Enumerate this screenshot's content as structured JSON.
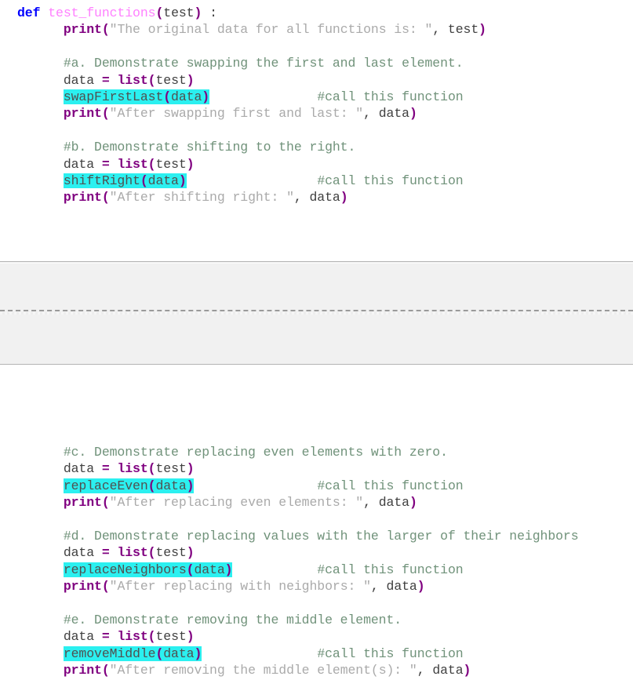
{
  "editor": {
    "language": "python",
    "colors": {
      "background": "#ffffff",
      "keyword": "#0000ff",
      "function_name": "#ff80ff",
      "builtin": "#800080",
      "punctuation": "#800080",
      "string": "#aaaaaa",
      "comment": "#70927a",
      "plain_text": "#404040",
      "highlight_background": "#2bf0f0",
      "fold_band_background": "#f1f1f1",
      "fold_band_border": "#b4b4b4"
    }
  },
  "code_top": {
    "lines": [
      {
        "id": "def-line",
        "tokens": [
          {
            "t": "def",
            "c": "def"
          },
          {
            "t": " ",
            "c": "plain"
          },
          {
            "t": "test_functions",
            "c": "fname"
          },
          {
            "t": "(",
            "c": "punct"
          },
          {
            "t": "test",
            "c": "plain"
          },
          {
            "t": ")",
            "c": "punct"
          },
          {
            "t": " :",
            "c": "plain"
          }
        ]
      },
      {
        "id": "print-original",
        "indent": 3,
        "tokens": [
          {
            "t": "print",
            "c": "builtin"
          },
          {
            "t": "(",
            "c": "punct"
          },
          {
            "t": "\"The original data for all functions is: \"",
            "c": "string"
          },
          {
            "t": ",",
            "c": "plain"
          },
          {
            "t": " test",
            "c": "plain"
          },
          {
            "t": ")",
            "c": "punct"
          }
        ]
      },
      {
        "id": "blank-1",
        "blank": true,
        "tokens": []
      },
      {
        "id": "comment-a",
        "indent": 3,
        "tokens": [
          {
            "t": "#a. Demonstrate swapping the first and last element.",
            "c": "comment"
          }
        ]
      },
      {
        "id": "data-assign-a",
        "indent": 3,
        "tokens": [
          {
            "t": "data ",
            "c": "plain"
          },
          {
            "t": "=",
            "c": "op"
          },
          {
            "t": " ",
            "c": "plain"
          },
          {
            "t": "list",
            "c": "builtin"
          },
          {
            "t": "(",
            "c": "punct"
          },
          {
            "t": "test",
            "c": "plain"
          },
          {
            "t": ")",
            "c": "punct"
          }
        ]
      },
      {
        "id": "call-swapfirstlast",
        "indent": 3,
        "highlight": {
          "text": "swapFirstLast",
          "open": "(",
          "arg": "data",
          "close": ")"
        },
        "trailing_comment": "#call this function",
        "comment_col": 39,
        "tokens": []
      },
      {
        "id": "print-after-swap",
        "indent": 3,
        "tokens": [
          {
            "t": "print",
            "c": "builtin"
          },
          {
            "t": "(",
            "c": "punct"
          },
          {
            "t": "\"After swapping first and last: \"",
            "c": "string"
          },
          {
            "t": ",",
            "c": "plain"
          },
          {
            "t": " data",
            "c": "plain"
          },
          {
            "t": ")",
            "c": "punct"
          }
        ]
      },
      {
        "id": "blank-2",
        "blank": true,
        "tokens": []
      },
      {
        "id": "comment-b",
        "indent": 3,
        "tokens": [
          {
            "t": "#b. Demonstrate shifting to the right.",
            "c": "comment"
          }
        ]
      },
      {
        "id": "data-assign-b",
        "indent": 3,
        "tokens": [
          {
            "t": "data ",
            "c": "plain"
          },
          {
            "t": "=",
            "c": "op"
          },
          {
            "t": " ",
            "c": "plain"
          },
          {
            "t": "list",
            "c": "builtin"
          },
          {
            "t": "(",
            "c": "punct"
          },
          {
            "t": "test",
            "c": "plain"
          },
          {
            "t": ")",
            "c": "punct"
          }
        ]
      },
      {
        "id": "call-shiftright",
        "indent": 3,
        "highlight": {
          "text": "shiftRight",
          "open": "(",
          "arg": "data",
          "close": ")"
        },
        "trailing_comment": "#call this function",
        "comment_col": 39,
        "tokens": []
      },
      {
        "id": "print-after-shift",
        "indent": 3,
        "tokens": [
          {
            "t": "print",
            "c": "builtin"
          },
          {
            "t": "(",
            "c": "punct"
          },
          {
            "t": "\"After shifting right: \"",
            "c": "string"
          },
          {
            "t": ",",
            "c": "plain"
          },
          {
            "t": " data",
            "c": "plain"
          },
          {
            "t": ")",
            "c": "punct"
          }
        ]
      }
    ]
  },
  "code_bottom": {
    "lines": [
      {
        "id": "comment-c",
        "indent": 3,
        "tokens": [
          {
            "t": "#c. Demonstrate replacing even elements with zero.",
            "c": "comment"
          }
        ]
      },
      {
        "id": "data-assign-c",
        "indent": 3,
        "tokens": [
          {
            "t": "data ",
            "c": "plain"
          },
          {
            "t": "=",
            "c": "op"
          },
          {
            "t": " ",
            "c": "plain"
          },
          {
            "t": "list",
            "c": "builtin"
          },
          {
            "t": "(",
            "c": "punct"
          },
          {
            "t": "test",
            "c": "plain"
          },
          {
            "t": ")",
            "c": "punct"
          }
        ]
      },
      {
        "id": "call-replaceeven",
        "indent": 3,
        "highlight": {
          "text": "replaceEven",
          "open": "(",
          "arg": "data",
          "close": ")"
        },
        "trailing_comment": "#call this function",
        "comment_col": 39,
        "tokens": []
      },
      {
        "id": "print-after-replaceeven",
        "indent": 3,
        "tokens": [
          {
            "t": "print",
            "c": "builtin"
          },
          {
            "t": "(",
            "c": "punct"
          },
          {
            "t": "\"After replacing even elements: \"",
            "c": "string"
          },
          {
            "t": ",",
            "c": "plain"
          },
          {
            "t": " data",
            "c": "plain"
          },
          {
            "t": ")",
            "c": "punct"
          }
        ]
      },
      {
        "id": "blank-3",
        "blank": true,
        "tokens": []
      },
      {
        "id": "comment-d",
        "indent": 3,
        "tokens": [
          {
            "t": "#d. Demonstrate replacing values with the larger of their neighbors",
            "c": "comment"
          }
        ]
      },
      {
        "id": "data-assign-d",
        "indent": 3,
        "tokens": [
          {
            "t": "data ",
            "c": "plain"
          },
          {
            "t": "=",
            "c": "op"
          },
          {
            "t": " ",
            "c": "plain"
          },
          {
            "t": "list",
            "c": "builtin"
          },
          {
            "t": "(",
            "c": "punct"
          },
          {
            "t": "test",
            "c": "plain"
          },
          {
            "t": ")",
            "c": "punct"
          }
        ]
      },
      {
        "id": "call-replaceneighbors",
        "indent": 3,
        "highlight": {
          "text": "replaceNeighbors",
          "open": "(",
          "arg": "data",
          "close": ")"
        },
        "trailing_comment": "#call this function",
        "comment_col": 39,
        "tokens": []
      },
      {
        "id": "print-after-replaceneighbors",
        "indent": 3,
        "tokens": [
          {
            "t": "print",
            "c": "builtin"
          },
          {
            "t": "(",
            "c": "punct"
          },
          {
            "t": "\"After replacing with neighbors: \"",
            "c": "string"
          },
          {
            "t": ",",
            "c": "plain"
          },
          {
            "t": " data",
            "c": "plain"
          },
          {
            "t": ")",
            "c": "punct"
          }
        ]
      },
      {
        "id": "blank-4",
        "blank": true,
        "tokens": []
      },
      {
        "id": "comment-e",
        "indent": 3,
        "tokens": [
          {
            "t": "#e. Demonstrate removing the middle element.",
            "c": "comment"
          }
        ]
      },
      {
        "id": "data-assign-e",
        "indent": 3,
        "tokens": [
          {
            "t": "data ",
            "c": "plain"
          },
          {
            "t": "=",
            "c": "op"
          },
          {
            "t": " ",
            "c": "plain"
          },
          {
            "t": "list",
            "c": "builtin"
          },
          {
            "t": "(",
            "c": "punct"
          },
          {
            "t": "test",
            "c": "plain"
          },
          {
            "t": ")",
            "c": "punct"
          }
        ]
      },
      {
        "id": "call-removemiddle",
        "indent": 3,
        "highlight": {
          "text": "removeMiddle",
          "open": "(",
          "arg": "data",
          "close": ")"
        },
        "trailing_comment": "#call this function",
        "comment_col": 39,
        "tokens": []
      },
      {
        "id": "print-after-removemiddle",
        "indent": 3,
        "tokens": [
          {
            "t": "print",
            "c": "builtin"
          },
          {
            "t": "(",
            "c": "punct"
          },
          {
            "t": "\"After removing the middle element(s): \"",
            "c": "string"
          },
          {
            "t": ",",
            "c": "plain"
          },
          {
            "t": " data",
            "c": "plain"
          },
          {
            "t": ")",
            "c": "punct"
          }
        ]
      }
    ]
  },
  "fold_band": {
    "label": ""
  }
}
